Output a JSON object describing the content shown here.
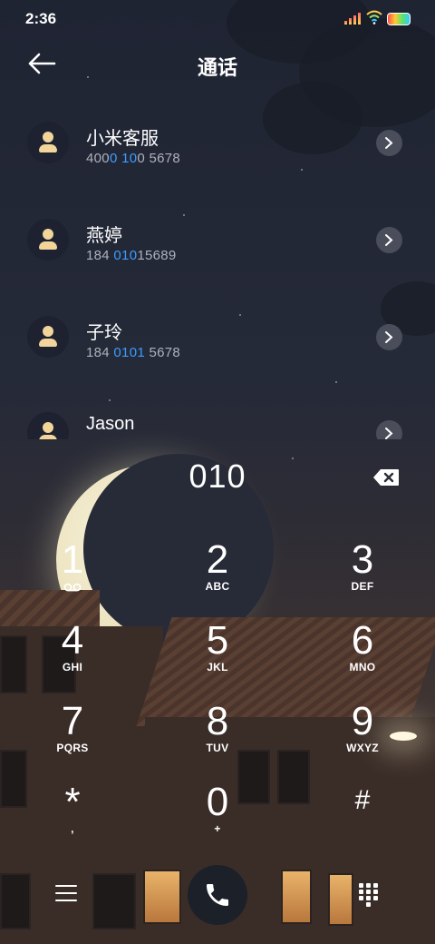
{
  "status_bar": {
    "time": "2:36",
    "icons": [
      "signal-icon",
      "wifi-icon",
      "battery-icon"
    ]
  },
  "header": {
    "title": "通话",
    "back_icon": "back-arrow-icon"
  },
  "contacts": [
    {
      "name": "小米客服",
      "number_parts": [
        {
          "t": "400",
          "hl": false
        },
        {
          "t": "0 ",
          "hl": true
        },
        {
          "t": "10",
          "hl": true
        },
        {
          "t": "0 5678",
          "hl": false
        }
      ]
    },
    {
      "name": "燕婷",
      "number_parts": [
        {
          "t": "184 ",
          "hl": false
        },
        {
          "t": "010",
          "hl": true
        },
        {
          "t": "15689",
          "hl": false
        }
      ]
    },
    {
      "name": "子玲",
      "number_parts": [
        {
          "t": "184 ",
          "hl": false
        },
        {
          "t": "0101",
          "hl": true
        },
        {
          "t": " 5678",
          "hl": false
        }
      ]
    },
    {
      "name": "Jason",
      "number_parts": []
    }
  ],
  "dial": {
    "number": "010",
    "delete_icon": "backspace-icon"
  },
  "keys": [
    {
      "digit": "1",
      "letters": "",
      "icon": "voicemail-icon"
    },
    {
      "digit": "2",
      "letters": "ABC"
    },
    {
      "digit": "3",
      "letters": "DEF"
    },
    {
      "digit": "4",
      "letters": "GHI"
    },
    {
      "digit": "5",
      "letters": "JKL"
    },
    {
      "digit": "6",
      "letters": "MNO"
    },
    {
      "digit": "7",
      "letters": "PQRS"
    },
    {
      "digit": "8",
      "letters": "TUV"
    },
    {
      "digit": "9",
      "letters": "WXYZ"
    },
    {
      "digit": "*",
      "letters": ","
    },
    {
      "digit": "0",
      "letters": "+"
    },
    {
      "digit": "#",
      "letters": ""
    }
  ],
  "bottom_bar": {
    "menu_icon": "menu-icon",
    "call_icon": "phone-icon",
    "dialpad_icon": "dialpad-icon"
  },
  "colors": {
    "highlight": "#3c9cff",
    "avatar": "#f1d59a",
    "call_button": "#1c2029"
  }
}
